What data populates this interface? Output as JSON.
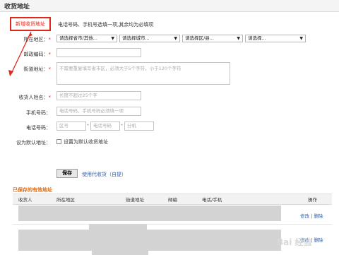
{
  "header": {
    "title": "收货地址"
  },
  "new_address": {
    "label": "新增收货地址",
    "tip": "电话号码、手机号选填一项,其余均为必填项"
  },
  "form": {
    "region": {
      "label": "所在地区：",
      "selects": [
        "请选择省市/其他...",
        "请选择城市...",
        "请选择区/县...",
        "请选择..."
      ]
    },
    "zip": {
      "label": "邮政编码：",
      "value": ""
    },
    "street": {
      "label": "街道地址：",
      "placeholder": "不需要重复填写省市区，必须大于5个字符，小于120个字符"
    },
    "name": {
      "label": "收货人姓名：",
      "placeholder": "长度不超过25个字"
    },
    "mobile": {
      "label": "手机号码：",
      "placeholder": "电话号码、手机号码必须填一项"
    },
    "phone": {
      "label": "电话号码：",
      "area": "区号",
      "number": "电话号码",
      "ext": "分机",
      "sep": "-"
    },
    "default": {
      "label": "设为默认地址：",
      "checkbox_label": "设置为默认收货地址"
    },
    "save_label": "保存",
    "alipay_link": "使用代收货（自提）",
    "required_mark": "*"
  },
  "saved": {
    "title": "已保存的有效地址",
    "columns": [
      "收货人",
      "所在地区",
      "街道地址",
      "邮编",
      "电话/手机",
      "操作"
    ],
    "rows": [
      {
        "edit": "修改",
        "sep": "|",
        "delete": "删除"
      },
      {
        "edit": "修改",
        "sep": "|",
        "delete": "删除"
      }
    ]
  },
  "watermark": "Bai 经验",
  "colors": {
    "accent_red": "#e0271a",
    "link_blue": "#2a5fb0",
    "saved_orange": "#e46a10"
  }
}
